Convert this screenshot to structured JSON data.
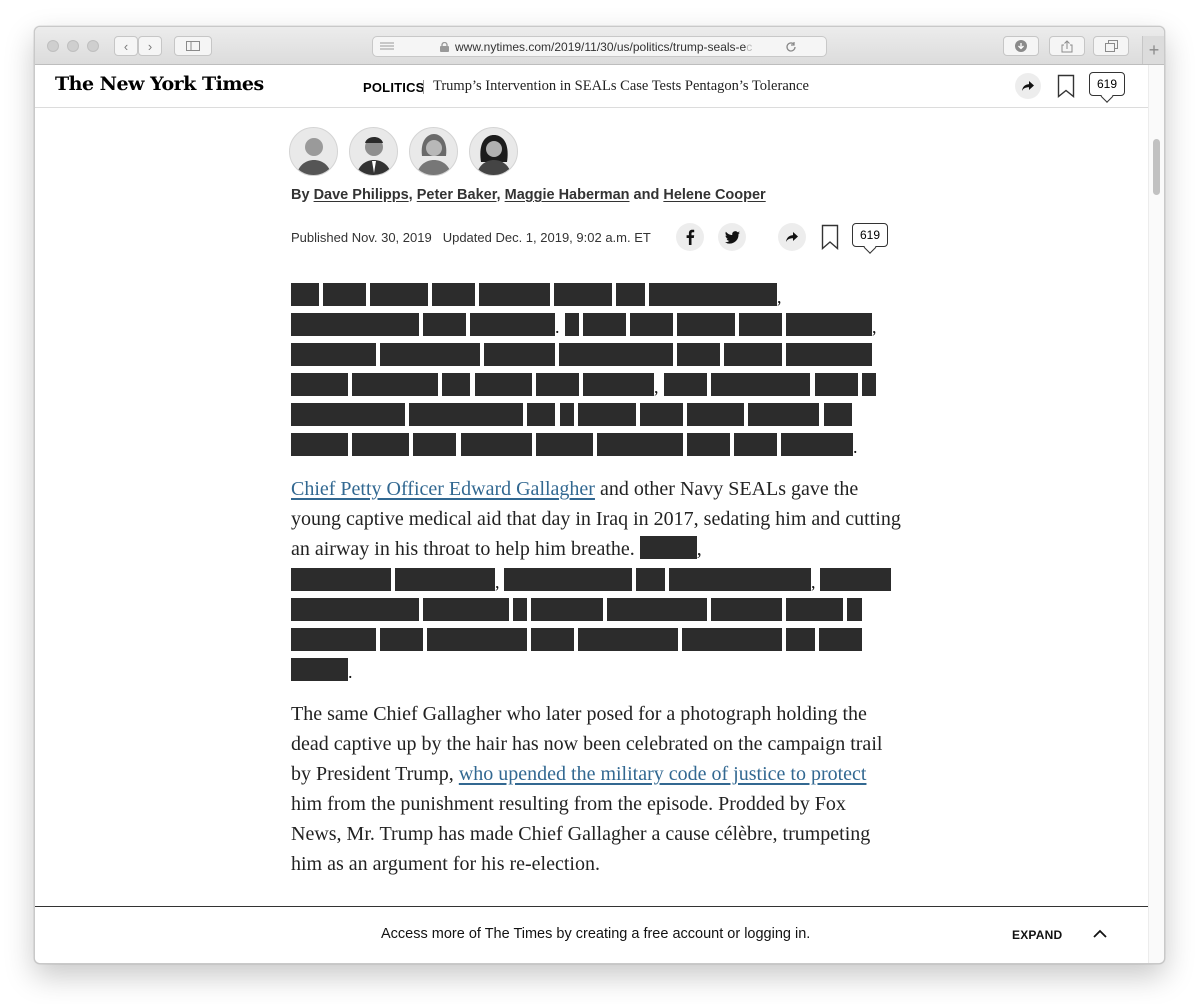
{
  "browser": {
    "url": "www.nytimes.com/2019/11/30/us/politics/trump-seals-e",
    "url_fade": "c"
  },
  "header": {
    "logo": "The New York Times",
    "section": "POLITICS",
    "headline": "Trump’s Intervention in SEALs Case Tests Pentagon’s Tolerance",
    "comment_count": "619"
  },
  "byline": {
    "prefix": "By ",
    "authors": [
      "Dave Philipps",
      "Peter Baker",
      "Maggie Haberman",
      "Helene Cooper"
    ],
    "sep1": ", ",
    "sep2": ", ",
    "sep3": " and "
  },
  "dates": {
    "published": "Published Nov. 30, 2019",
    "updated": "Updated Dec. 1, 2019, 9:02 a.m. ET",
    "comment_count": "619"
  },
  "paragraph2": {
    "link": "Chief Petty Officer Edward Gallagher",
    "text": " and other Navy SEALs gave the young captive medical aid that day in Iraq in 2017, sedating him and cutting an airway in his throat to help him breathe."
  },
  "paragraph3": {
    "text_before": "The same Chief Gallagher who later posed for a photograph holding the dead captive up by the hair has now been celebrated on the campaign trail by President Trump, ",
    "link": "who upended the military code of justice to protect ",
    "text_after": "him from the punishment resulting from the episode. Prodded by Fox News, Mr. Trump has made Chief Gallagher a cause célèbre, trumpeting him as an argument for his re-election."
  },
  "gate": {
    "message": "Access more of The Times by creating a free account or logging in.",
    "expand_label": "EXPAND"
  },
  "icons": {
    "share": "share-arrow-icon",
    "bookmark": "bookmark-icon",
    "comments": "comment-bubble-icon",
    "facebook": "facebook-icon",
    "twitter": "twitter-icon",
    "collapse": "chevron-up-icon"
  },
  "colors": {
    "link": "#326891",
    "redaction": "#2c2c2c"
  }
}
